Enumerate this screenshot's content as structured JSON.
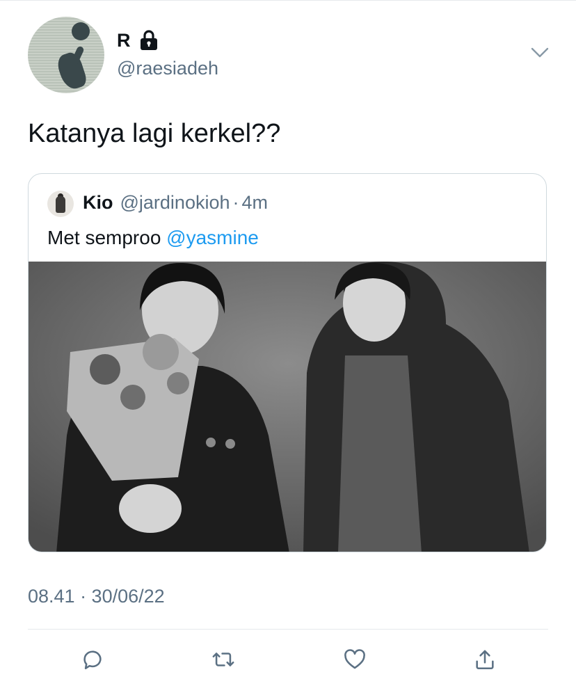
{
  "author": {
    "display_name": "R",
    "handle": "@raesiadeh",
    "avatar_icon": "avatar-image",
    "protected_icon": "lock-icon"
  },
  "tweet": {
    "text": "Katanya lagi kerkel??",
    "timestamp": "08.41 · 30/06/22"
  },
  "quoted_tweet": {
    "display_name": "Kio",
    "handle": "@jardinokioh",
    "separator": "·",
    "time": "4m",
    "text": "Met semproo ",
    "mention": "@yasmine",
    "media": "photo-black-and-white-two-people"
  },
  "actions": [
    {
      "name": "reply",
      "icon": "reply-icon"
    },
    {
      "name": "retweet",
      "icon": "retweet-icon"
    },
    {
      "name": "like",
      "icon": "like-icon"
    },
    {
      "name": "share",
      "icon": "share-icon"
    }
  ],
  "colors": {
    "text": "#0f1419",
    "secondary": "#5b7083",
    "link": "#1d9bf0",
    "border": "#cfd9de"
  }
}
